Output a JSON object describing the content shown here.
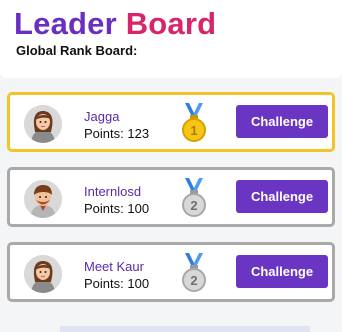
{
  "header": {
    "title_part1": "Leader",
    "title_part2": "Board",
    "subtitle": "Global Rank Board:"
  },
  "colors": {
    "title_primary": "#6a2fbf",
    "title_accent": "#d8246a",
    "button": "#6a35c3",
    "first_place_border": "#f1c52a",
    "card_border": "#a9a9a9"
  },
  "leaderboard": [
    {
      "name": "Jagga",
      "points": "Points: 123",
      "rank": "1",
      "medal": "gold-medal-icon",
      "button_label": "Challenge",
      "avatar": "female-avatar-icon"
    },
    {
      "name": "Internlosd",
      "points": "Points: 100",
      "rank": "2",
      "medal": "silver-medal-icon",
      "button_label": "Challenge",
      "avatar": "male-avatar-icon"
    },
    {
      "name": "Meet Kaur",
      "points": "Points: 100",
      "rank": "2",
      "medal": "silver-medal-icon",
      "button_label": "Challenge",
      "avatar": "female-avatar-icon"
    }
  ]
}
